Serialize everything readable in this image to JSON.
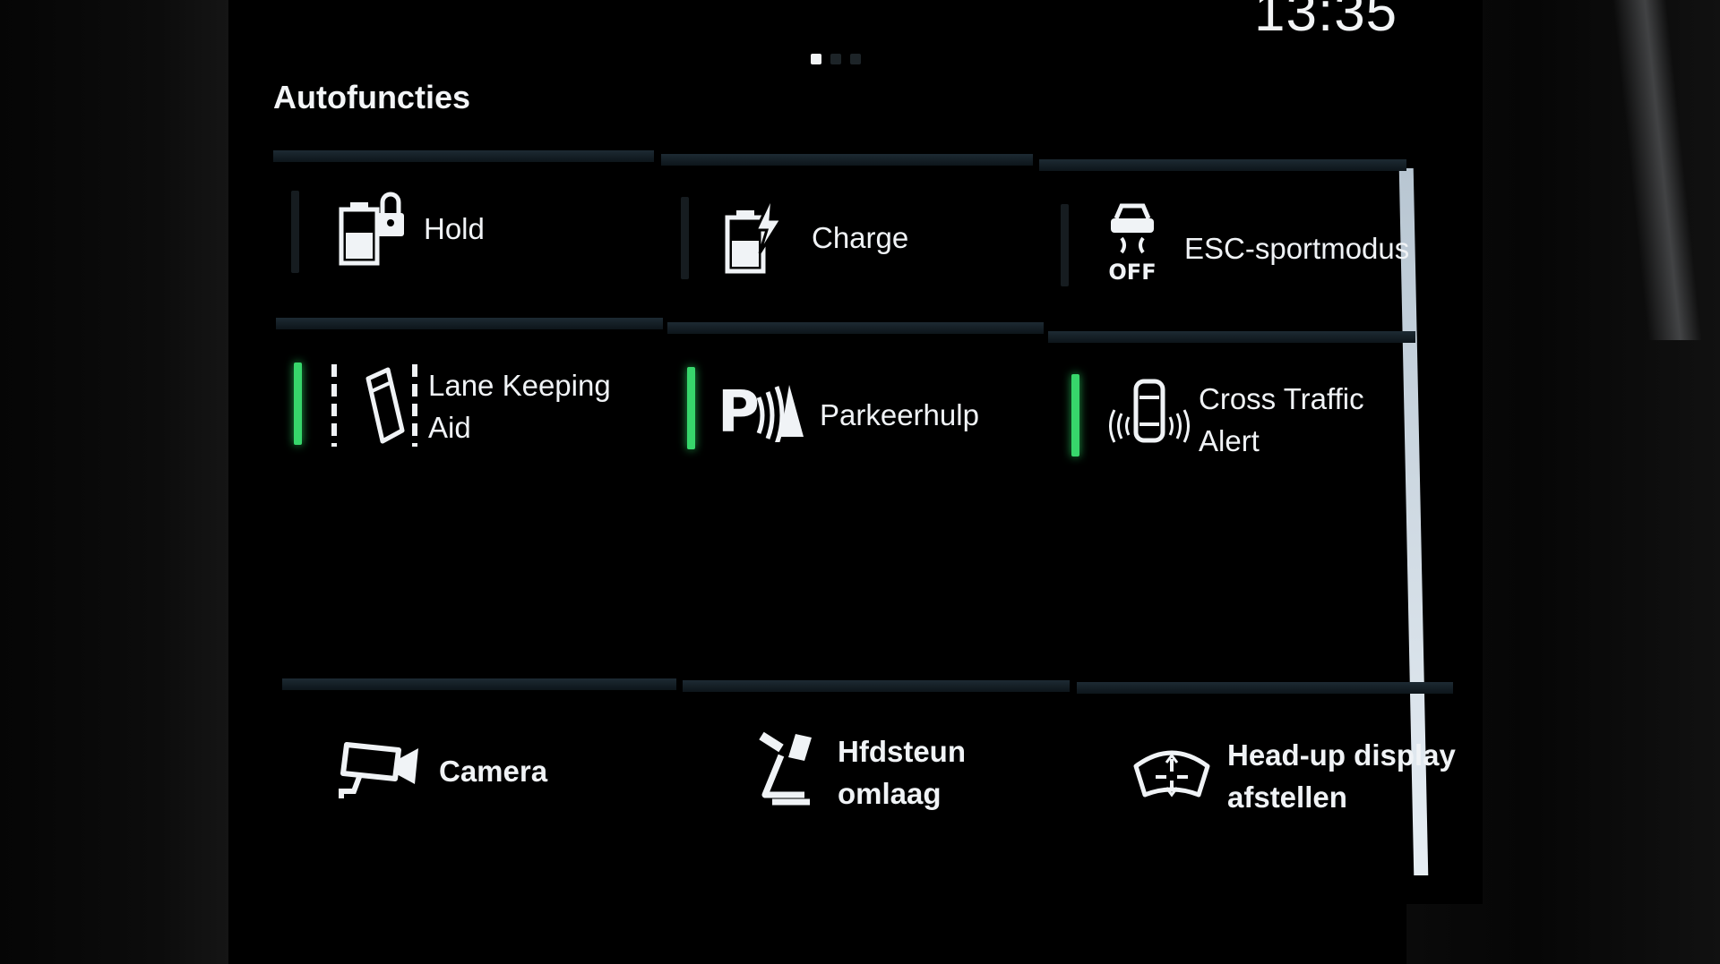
{
  "status": {
    "clock": "13:35"
  },
  "pager": {
    "count": 3,
    "active": 0
  },
  "screen": {
    "title": "Autofuncties"
  },
  "tiles": {
    "hold": {
      "label": "Hold",
      "active": false
    },
    "charge": {
      "label": "Charge",
      "active": false
    },
    "esc": {
      "label": "ESC-sportmodus",
      "active": false,
      "icon_text": "OFF"
    },
    "lka": {
      "line1": "Lane Keeping",
      "line2": "Aid",
      "active": true
    },
    "park": {
      "label": "Parkeerhulp",
      "active": true,
      "icon_text": "P"
    },
    "cta": {
      "line1": "Cross Traffic",
      "line2": "Alert",
      "active": true
    },
    "camera": {
      "label": "Camera"
    },
    "headrest": {
      "line1": "Hfdsteun",
      "line2": "omlaag"
    },
    "hud": {
      "line1": "Head-up display",
      "line2": "afstellen"
    }
  },
  "colors": {
    "indicator_on": "#37d66b",
    "indicator_off": "#161c20",
    "text": "#f0f3f6",
    "background": "#000000"
  }
}
